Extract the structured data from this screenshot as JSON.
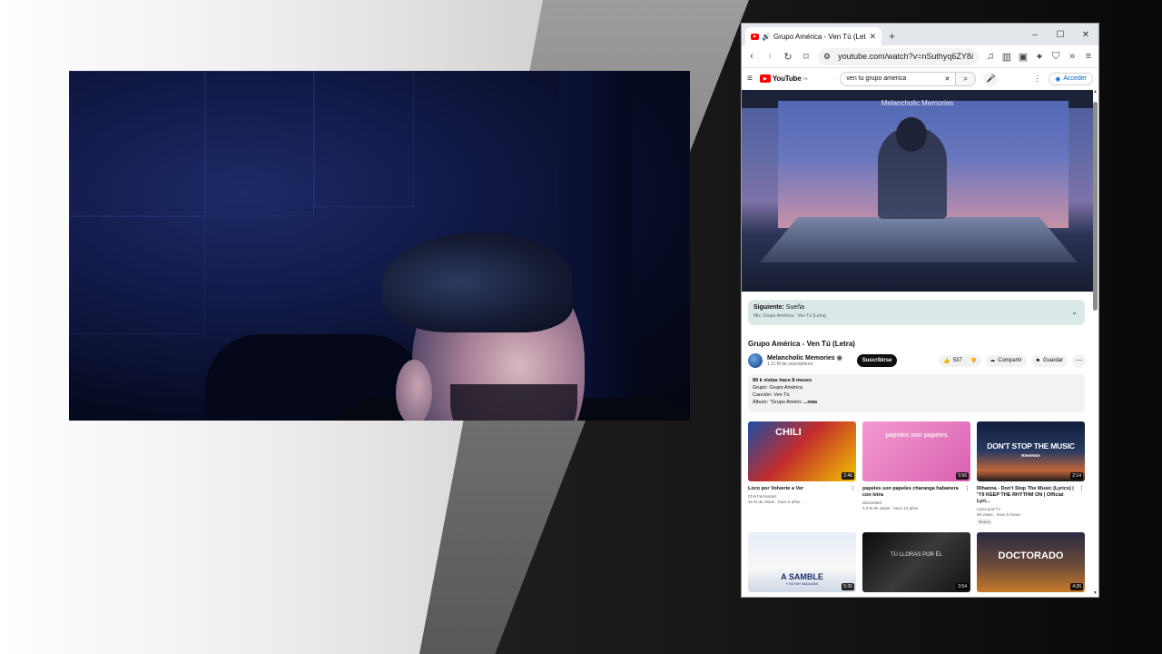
{
  "browser": {
    "tab_title": "Grupo América - Ven Tú (Letr",
    "url": "youtube.com/watch?v=nSuthyq6ZY8&",
    "new_tab": "+",
    "window_controls": [
      "–",
      "☐",
      "✕"
    ]
  },
  "youtube": {
    "logo": "YouTube",
    "logo_country": "TR",
    "search_value": "ven tu grupo america",
    "signin_label": "Acceder"
  },
  "player": {
    "caption": "Melancholic Memories"
  },
  "up_next": {
    "label": "Siguiente:",
    "title": "Sueña",
    "mix": "Mix: Grupo América · Ven Tú (Letra)"
  },
  "video": {
    "title": "Grupo América - Ven Tú (Letra)",
    "channel": "Melancholic Memories",
    "subscribers": "1.11 M de suscriptores",
    "subscribe_label": "Suscribirse",
    "likes": "537",
    "share_label": "Compartir",
    "save_label": "Guardar"
  },
  "description": {
    "stats": "89 k vistas  hace 8 meses",
    "line1": "Grupo: Grupo América",
    "line2": "Canción: Ven Tú",
    "line3": "Álbum: \"Grupo Améric",
    "more": "...más"
  },
  "recommendations": [
    {
      "title": "Loco por Volverte a Ver",
      "channel": "Chili Fernández",
      "meta": "42 M de vistas · hace 6 años",
      "duration": "2:46",
      "thumb_text": "CHILI",
      "badge": ""
    },
    {
      "title": "papeles son papeles charanga habanera con letra",
      "channel": "alnuria363",
      "meta": "3.3 M de vistas · hace 13 años",
      "duration": "5:56",
      "thumb_text": "papeles son papeles",
      "badge": ""
    },
    {
      "title": "Rihanna - Don't Stop The Music (Lyrics) | \"I'll KEEP THE RHYTHM ON | Official Lyri...",
      "channel": "LyricLand TV",
      "meta": "96 vistas · hace 5 horas",
      "duration": "2:14",
      "thumb_text": "DON'T STOP THE MUSIC",
      "thumb_sub": "RIHANNA",
      "badge": "Nuevo"
    },
    {
      "title": "",
      "channel": "",
      "meta": "",
      "duration": "5:35",
      "thumb_text": "A SAMBLE",
      "thumb_sub": "Y NO HAY NADA MÁS",
      "badge": ""
    },
    {
      "title": "",
      "channel": "",
      "meta": "",
      "duration": "3:54",
      "thumb_text": "TÚ LLORAS POR ÉL",
      "badge": ""
    },
    {
      "title": "",
      "channel": "",
      "meta": "",
      "duration": "4:26",
      "thumb_text": "DOCTORADO",
      "badge": ""
    }
  ],
  "colors": {
    "youtube_red": "#ff0000",
    "link_blue": "#065fd4",
    "up_next_bg": "#dbe8e8"
  }
}
